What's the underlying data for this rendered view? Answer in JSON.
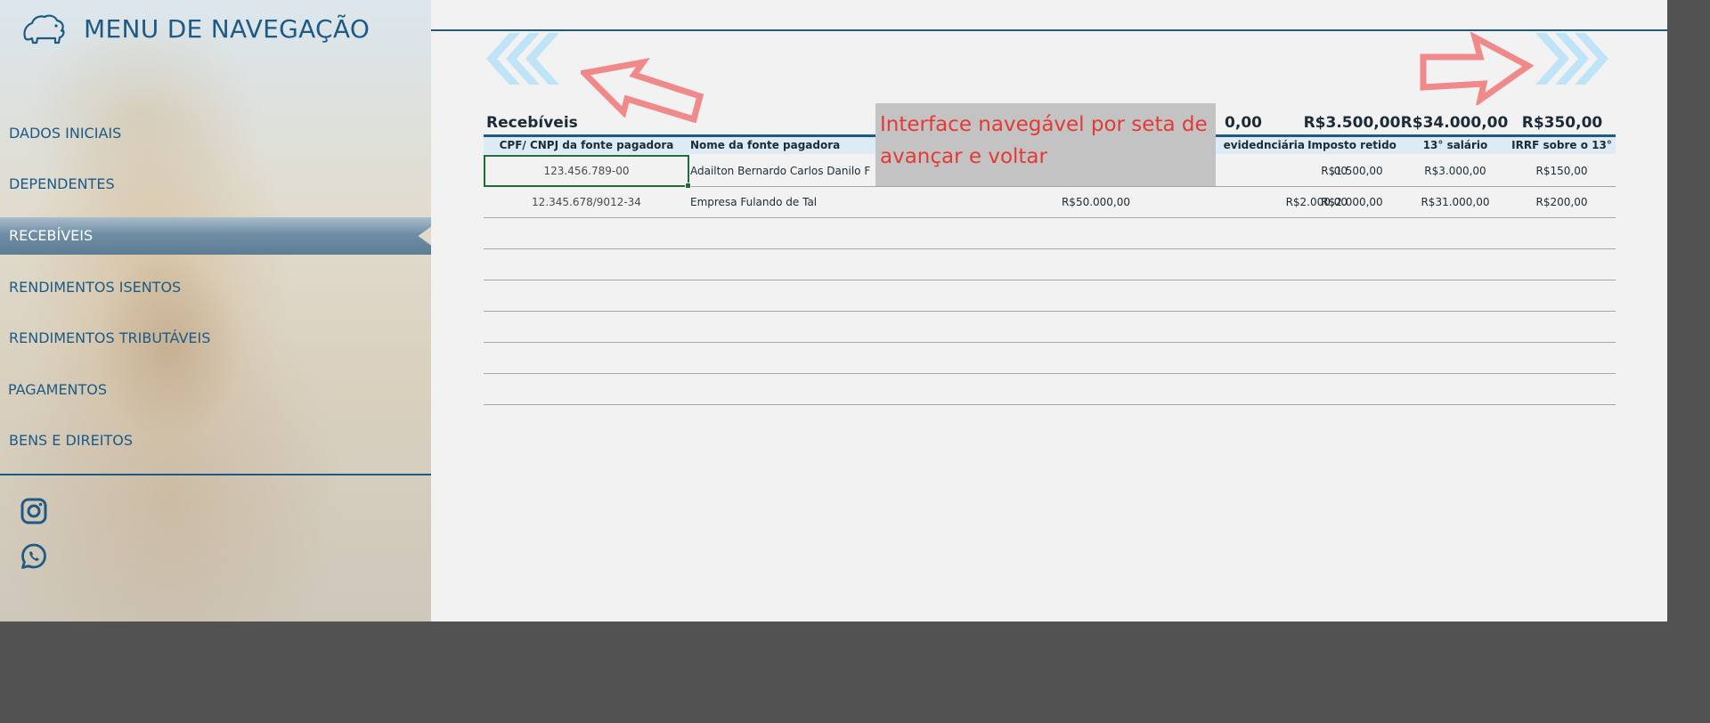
{
  "sidebar": {
    "title": "MENU DE NAVEGAÇÃO",
    "items": [
      {
        "label": "DADOS INICIAIS",
        "active": false
      },
      {
        "label": "DEPENDENTES",
        "active": false
      },
      {
        "label": "RECEBÍVEIS",
        "active": true
      },
      {
        "label": "RENDIMENTOS ISENTOS",
        "active": false
      },
      {
        "label": "RENDIMENTOS TRIBUTÁVEIS",
        "active": false
      },
      {
        "label": "PAGAMENTOS",
        "active": false
      },
      {
        "label": "BENS E DIREITOS",
        "active": false
      }
    ],
    "social": [
      "instagram-icon",
      "whatsapp-icon"
    ]
  },
  "colors": {
    "accent": "#1d5a86",
    "header_fill": "#ddebf7",
    "chevron": "#bfe3f7",
    "annotation_arrow": "#f08a8a",
    "note_text": "#e53935",
    "note_background": "#c3c3c3",
    "selection": "#1f6b3a"
  },
  "main": {
    "section_title": "Recebíveis",
    "totals": [
      "0,00",
      "R$3.500,00",
      "R$34.000,00",
      "R$350,00"
    ],
    "columns": [
      "CPF/ CNPJ da fonte pagadora",
      "Nome da fonte pagadora",
      "",
      "evidednciária",
      "Imposto retido",
      "13° salário",
      "IRRF sobre o 13°"
    ],
    "rows": [
      {
        "cpf": "123.456.789-00",
        "nome": "Adailton Bernardo Carlos Danilo F",
        "rendimentos": "",
        "previdencia": ",00",
        "imposto": "R$1.500,00",
        "decimo": "R$3.000,00",
        "irrf": "R$150,00"
      },
      {
        "cpf": "12.345.678/9012-34",
        "nome": "Empresa Fulando de Tal",
        "rendimentos": "R$50.000,00",
        "previdencia": "R$2.000,00",
        "imposto": "R$2.000,00",
        "decimo": "R$31.000,00",
        "irrf": "R$200,00"
      }
    ],
    "empty_rows": 6
  },
  "annotation": {
    "text": "Interface navegável por seta de avançar e voltar"
  }
}
